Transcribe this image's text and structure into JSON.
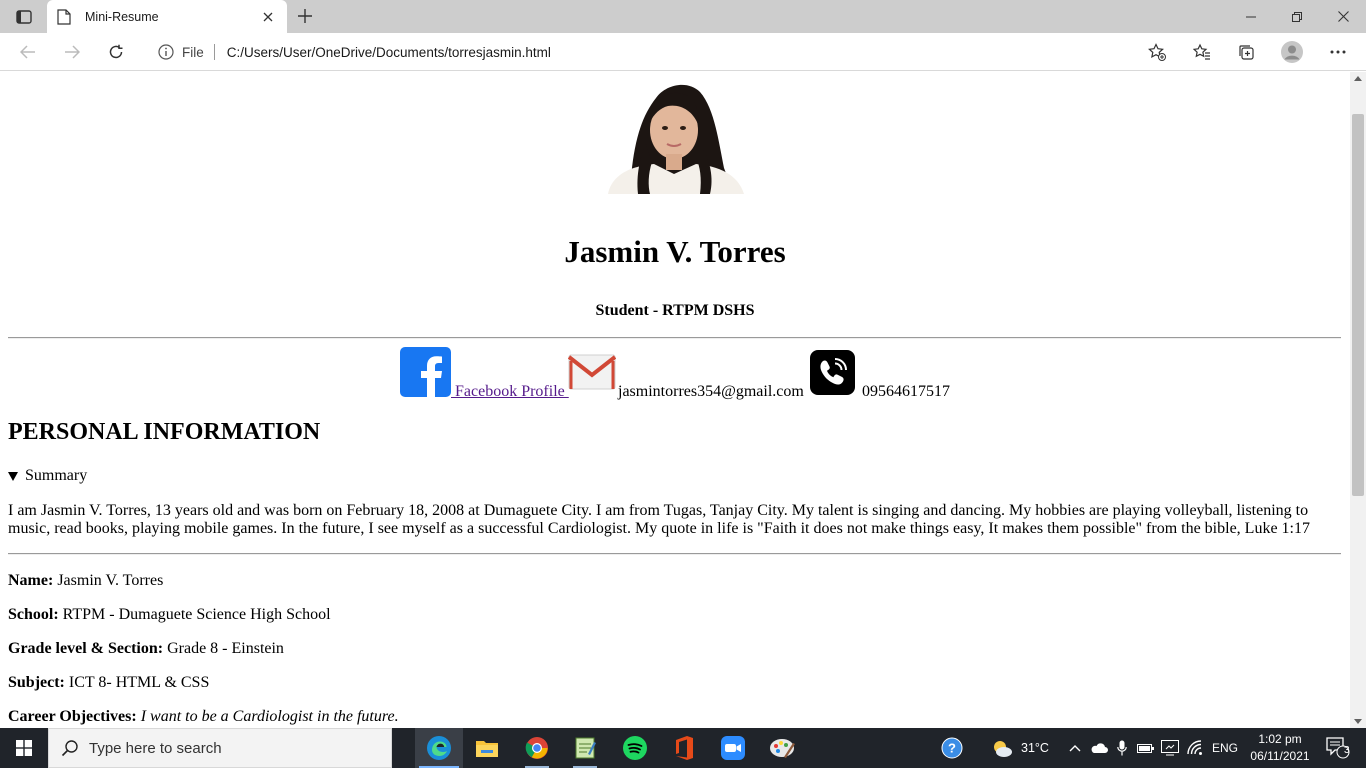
{
  "browser": {
    "tab_title": "Mini-Resume",
    "file_label": "File",
    "url": "C:/Users/User/OneDrive/Documents/torresjasmin.html"
  },
  "page": {
    "name": "Jasmin V. Torres",
    "role": "Student - RTPM DSHS",
    "contacts": {
      "facebook_label": " Facebook Profile ",
      "email": "jasmintorres354@gmail.com",
      "phone": " 09564617517"
    },
    "section_heading": "PERSONAL INFORMATION",
    "summary_label": "Summary",
    "summary_text": "I am Jasmin V. Torres, 13 years old and was born on February 18, 2008 at Dumaguete City. I am from Tugas, Tanjay City. My talent is singing and dancing. My hobbies are playing volleyball, listening to music, read books, playing mobile games. In the future, I see myself as a successful Cardiologist. My quote in life is \"Faith it does not make things easy, It makes them possible\" from the bible, Luke 1:17",
    "fields": {
      "name_label": "Name:",
      "name_value": " Jasmin V. Torres",
      "school_label": "School:",
      "school_value": " RTPM - Dumaguete Science High School",
      "grade_label": "Grade level & Section:",
      "grade_value": " Grade 8 - Einstein",
      "subject_label": "Subject:",
      "subject_value": " ICT 8- HTML & CSS",
      "career_label": "Career Objectives:",
      "career_value": "I want to be a Cardiologist in the future."
    }
  },
  "taskbar": {
    "search_placeholder": "Type here to search",
    "weather": "31°C",
    "language": "ENG",
    "time": "1:02 pm",
    "date": "06/11/2021",
    "notification_count": "3"
  }
}
